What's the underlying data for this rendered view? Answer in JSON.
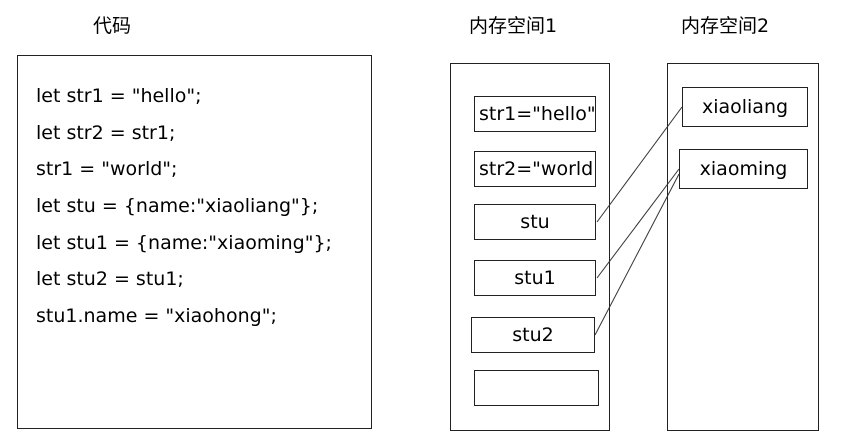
{
  "headings": {
    "code": "代码",
    "memory1": "内存空间1",
    "memory2": "内存空间2"
  },
  "code_lines": [
    "let str1 = \"hello\";",
    "let str2 = str1;",
    "str1 = \"world\";",
    "let stu = {name:\"xiaoliang\"};",
    "let stu1 = {name:\"xiaoming\"};",
    "let stu2 = stu1;",
    "stu1.name = \"xiaohong\";"
  ],
  "memory1_cells": [
    "str1=\"hello\"",
    "str2=\"world\"",
    "stu",
    "stu1",
    "stu2",
    ""
  ],
  "memory2_cells": [
    "xiaoliang",
    "xiaoming"
  ],
  "pointers": [
    {
      "from": "stu",
      "to": "xiaoliang"
    },
    {
      "from": "stu1",
      "to": "xiaoming"
    },
    {
      "from": "stu2",
      "to": "xiaoming"
    }
  ]
}
